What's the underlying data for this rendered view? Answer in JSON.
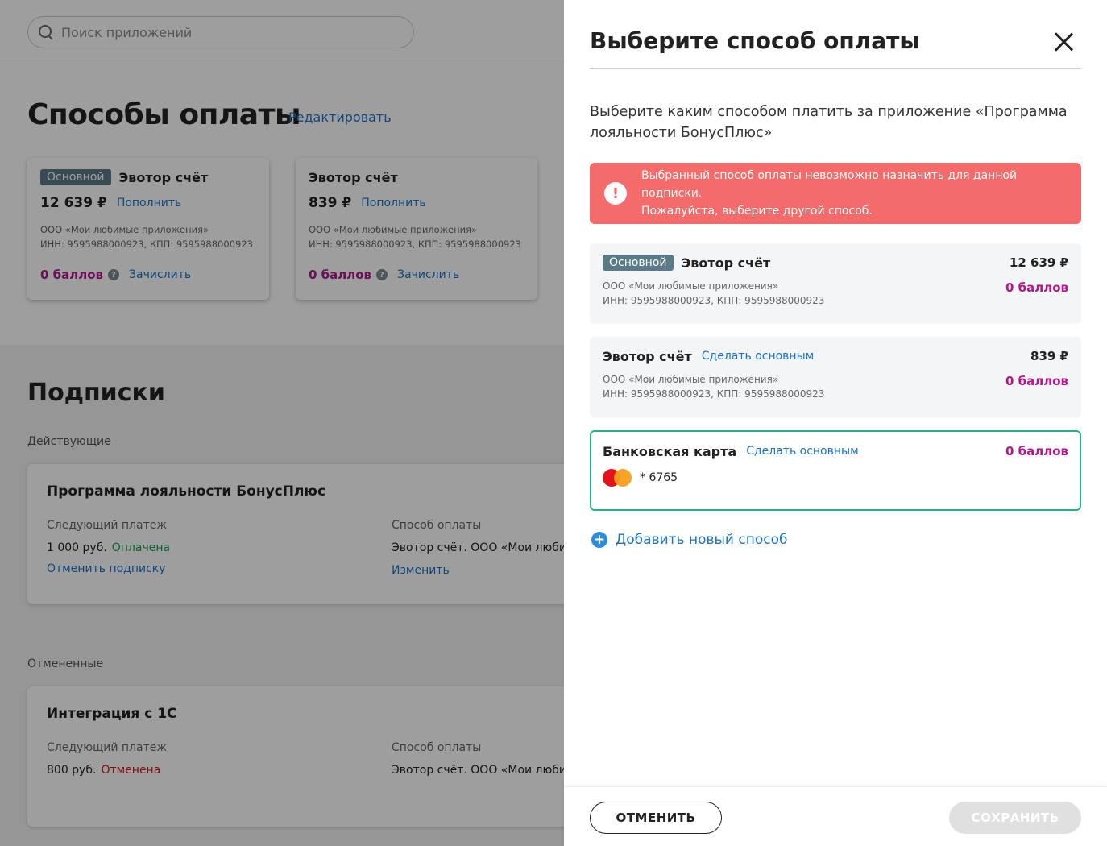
{
  "search": {
    "placeholder": "Поиск приложений"
  },
  "payment_methods": {
    "title": "Способы оплаты",
    "edit_label": "Редактировать",
    "cards": [
      {
        "badge": "Основной",
        "title": "Эвотор счёт",
        "amount": "12 639 ₽",
        "topup_label": "Пополнить",
        "org": "ООО «Мои любимые приложения»",
        "inn": "ИНН: 9595988000923, КПП: 9595988000923",
        "points": "0 баллов",
        "credit_label": "Зачислить"
      },
      {
        "title": "Эвотор счёт",
        "amount": "839 ₽",
        "topup_label": "Пополнить",
        "org": "ООО «Мои любимые приложения»",
        "inn": "ИНН: 9595988000923, КПП: 9595988000923",
        "points": "0 баллов",
        "credit_label": "Зачислить"
      }
    ]
  },
  "subscriptions": {
    "title": "Подписки",
    "active_label": "Действующие",
    "canceled_label": "Отмененные",
    "next_payment_label": "Следующий платеж",
    "payment_method_label": "Способ оплаты",
    "active": {
      "name": "Программа лояльности БонусПлюс",
      "amount": "1 000 руб.",
      "status": "Оплачена",
      "method": "Эвотор счёт. ООО «Мои любимые приложения»",
      "cancel_label": "Отменить подписку",
      "change_label": "Изменить"
    },
    "canceled": {
      "name": "Интеграция с 1С",
      "amount": "800 руб.",
      "status": "Отменена",
      "method": "Эвотор счёт. ООО «Мои любимые приложения»"
    }
  },
  "modal": {
    "title": "Выберите способ оплаты",
    "description": "Выберите каким способом платить за приложение «Программа лояльности БонусПлюс»",
    "alert": {
      "icon": "!",
      "line1": "Выбранный способ оплаты невозможно назначить для данной подписки.",
      "line2": "Пожалуйста, выберите другой способ."
    },
    "options": [
      {
        "badge": "Основной",
        "title": "Эвотор счёт",
        "amount": "12 639 ₽",
        "org": "ООО «Мои любимые приложения»",
        "inn": "ИНН: 9595988000923, КПП: 9595988000923",
        "points": "0 баллов"
      },
      {
        "title": "Эвотор счёт",
        "make_main_label": "Сделать основным",
        "amount": "839 ₽",
        "org": "ООО «Мои любимые приложения»",
        "inn": "ИНН: 9595988000923, КПП: 9595988000923",
        "points": "0 баллов"
      },
      {
        "title": "Банковская карта",
        "make_main_label": "Сделать основным",
        "points": "0 баллов",
        "card_mask": "* 6765",
        "card_icon": "mastercard-icon"
      }
    ],
    "add_new_label": "Добавить новый способ",
    "add_new_icon": "+",
    "cancel_label": "ОТМЕНИТЬ",
    "save_label": "СОХРАНИТЬ"
  },
  "colors": {
    "accent_link": "#1a73c8",
    "points": "#b0178e",
    "alert_bg": "#f36b6b",
    "selected_border": "#25b18a",
    "paid": "#1d9a52",
    "canceled": "#d11a1a"
  }
}
